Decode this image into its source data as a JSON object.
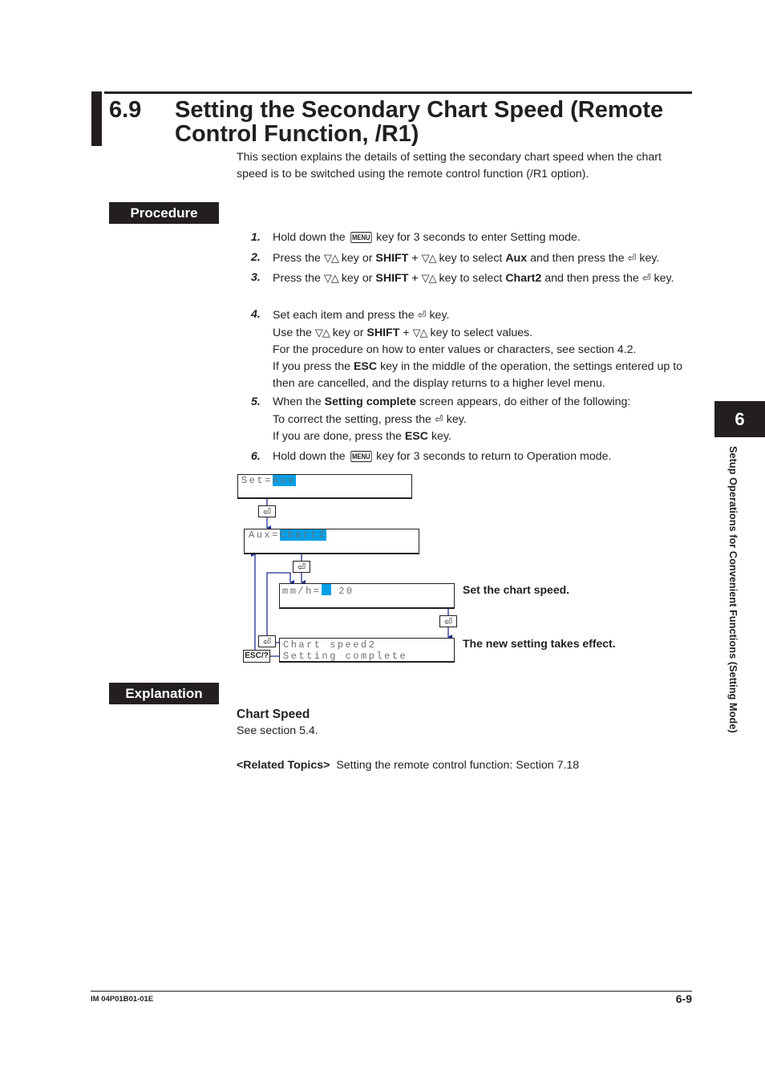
{
  "header": {
    "section_number": "6.9",
    "title": "Setting the Secondary Chart Speed (Remote Control Function, /R1)",
    "intro": "This section explains the details of setting the secondary chart speed when the chart speed is to be switched using the remote control function (/R1 option)."
  },
  "procedure": {
    "label": "Procedure",
    "steps": [
      {
        "num": "1.",
        "parts": {
          "a": "Hold down the ",
          "key": "MENU",
          "b": " key for 3 seconds to enter Setting mode."
        }
      },
      {
        "num": "2.",
        "parts": {
          "a": "Press the ",
          "arrows": "▽△",
          "b": " key or ",
          "shift": "SHIFT",
          "c": " + ",
          "d": " key to select ",
          "target": "Aux",
          "e": " and then press the ",
          "enter": "⏎",
          "f": " key."
        }
      },
      {
        "num": "3.",
        "parts": {
          "a": "Press the ",
          "arrows": "▽△",
          "b": " key or ",
          "shift": "SHIFT",
          "c": " + ",
          "d": " key to select ",
          "target": "Chart2",
          "e": " and then press the ",
          "enter": "⏎",
          "f": " key."
        }
      },
      {
        "num": "4.",
        "lines": {
          "l1a": "Set each item and press the ",
          "l1b": " key.",
          "l2a": "Use the ",
          "l2b": " key or ",
          "l2shift": "SHIFT",
          "l2c": " + ",
          "l2d": " key to select values.",
          "l3": "For the procedure on how to enter values or characters, see section 4.2.",
          "l4a": "If you press the ",
          "l4esc": "ESC",
          "l4b": " key in the middle of the operation, the settings entered up to then are cancelled, and the display returns to a higher level menu."
        }
      },
      {
        "num": "5.",
        "lines": {
          "l1a": "When the ",
          "l1bold": "Setting complete",
          "l1b": " screen appears, do either of the following:",
          "l2a": "To correct the setting, press the ",
          "l2b": " key.",
          "l3a": "If you are done, press the ",
          "l3esc": "ESC",
          "l3b": " key."
        }
      },
      {
        "num": "6.",
        "parts": {
          "a": "Hold down the ",
          "key": "MENU",
          "b": " key for 3 seconds to return to Operation mode."
        }
      }
    ]
  },
  "diagram": {
    "screen1": {
      "prefix": "Set=",
      "value": "Aux"
    },
    "screen2": {
      "prefix": "Aux=",
      "value": "Chart2"
    },
    "screen3": {
      "prefix": "mm/h=",
      "value": " 20",
      "note": "Set the chart speed."
    },
    "screen4": {
      "line1": "Chart speed2",
      "line2": "Setting complete",
      "note": "The new setting takes effect."
    },
    "enter_key": "⏎",
    "esc_key": "ESC/?",
    "line_color": "#1b2f8f",
    "highlight_color": "#00a0e9"
  },
  "explanation": {
    "label": "Explanation",
    "subhead": "Chart Speed",
    "body": "See section 5.4.",
    "related_label": "<Related Topics>",
    "related_text": "Setting the remote control function: Section 7.18"
  },
  "side_tab": {
    "chapter": "6",
    "text": "Setup Operations for Convenient Functions (Setting Mode)"
  },
  "footer": {
    "doc_id": "IM 04P01B01-01E",
    "page": "6-9"
  }
}
